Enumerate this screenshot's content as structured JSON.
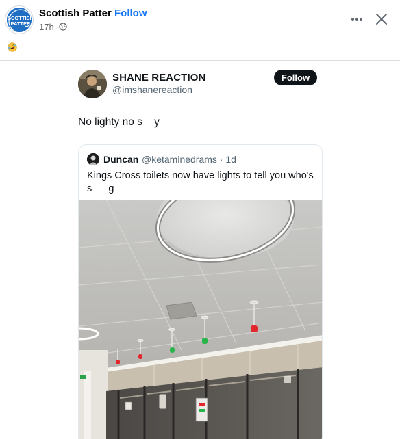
{
  "header": {
    "page_name": "Scottish Patter",
    "separator": "·",
    "follow_label": "Follow",
    "time": "17h ·",
    "logo_text_top": "SCOTTISH",
    "logo_text_bottom": "PATTER",
    "icons": {
      "globe": "globe-icon",
      "more": "more-horizontal-icon",
      "close": "close-icon",
      "emoji": "laughing-emoji-icon"
    }
  },
  "tweet": {
    "name": "SHANE REACTION",
    "handle": "@imshanereaction",
    "follow_label": "Follow",
    "text": "No lighty no s    y"
  },
  "quote": {
    "name": "Duncan",
    "handle_time": "@ketaminedrams · 1d",
    "text_line1": "Kings Cross toilets now have lights to tell you who's",
    "text_line2": "s      g"
  },
  "photo": {
    "description_icon": "toilet-ceiling-photo",
    "indicator_colors": [
      "#e3262b",
      "#29b34a",
      "#29b34a",
      "#e3262b",
      "#e3262b"
    ]
  },
  "colors": {
    "accent": "#1877f2",
    "logo": "#1e6fc4",
    "follow_button": "#0f1419"
  }
}
